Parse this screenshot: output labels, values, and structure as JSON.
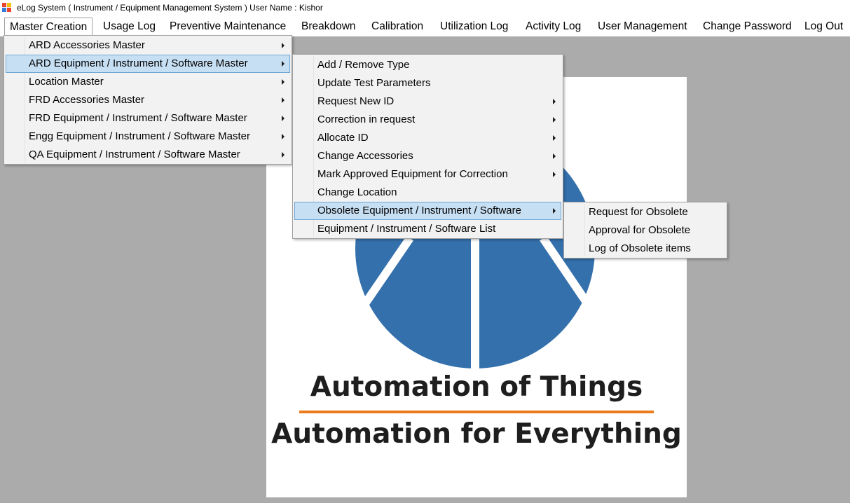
{
  "window": {
    "title": "eLog System ( Instrument / Equipment Management System )  User Name : Kishor"
  },
  "menubar": {
    "items": [
      {
        "label": "Master Creation"
      },
      {
        "label": "Usage Log"
      },
      {
        "label": "Preventive Maintenance"
      },
      {
        "label": "Breakdown"
      },
      {
        "label": "Calibration"
      },
      {
        "label": "Utilization Log"
      },
      {
        "label": "Activity Log"
      },
      {
        "label": "User Management"
      },
      {
        "label": "Change Password"
      },
      {
        "label": "Log Out"
      }
    ]
  },
  "master_menu": {
    "items": [
      {
        "label": "ARD Accessories Master"
      },
      {
        "label": "ARD Equipment / Instrument / Software Master"
      },
      {
        "label": "Location Master"
      },
      {
        "label": "FRD Accessories Master"
      },
      {
        "label": "FRD Equipment / Instrument / Software Master"
      },
      {
        "label": "Engg Equipment / Instrument / Software Master"
      },
      {
        "label": "QA Equipment / Instrument / Software Master"
      }
    ]
  },
  "ard_submenu": {
    "items": [
      {
        "label": "Add / Remove Type"
      },
      {
        "label": "Update Test Parameters"
      },
      {
        "label": "Request New  ID"
      },
      {
        "label": "Correction in request"
      },
      {
        "label": "Allocate  ID"
      },
      {
        "label": "Change Accessories"
      },
      {
        "label": "Mark Approved Equipment for Correction"
      },
      {
        "label": "Change Location"
      },
      {
        "label": "Obsolete Equipment / Instrument / Software"
      },
      {
        "label": "Equipment / Instrument / Software List"
      }
    ]
  },
  "obsolete_submenu": {
    "items": [
      {
        "label": "Request for Obsolete"
      },
      {
        "label": "Approval for Obsolete"
      },
      {
        "label": "Log of Obsolete items"
      }
    ]
  },
  "logo": {
    "line1": "Automation of Things",
    "line2": "Automation for Everything",
    "circle_color": "#3470ac",
    "rule_color": "#ec7b1e"
  },
  "colors": {
    "menu_highlight": "#c7dff3",
    "menu_bg": "#f2f2f2",
    "workspace_bg": "#ababab"
  }
}
